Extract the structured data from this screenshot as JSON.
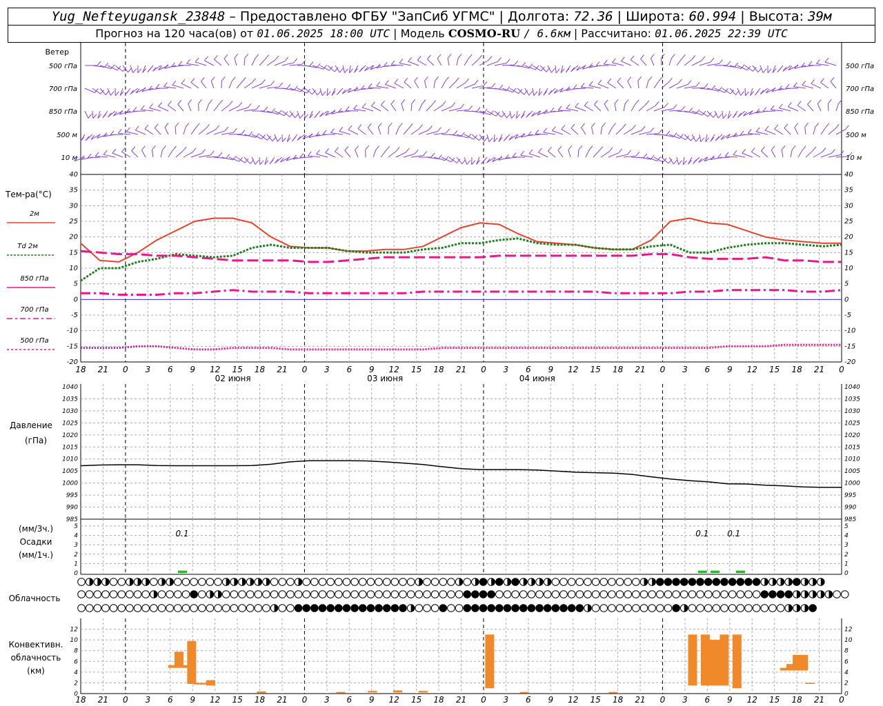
{
  "header": {
    "station": "Yug_Nefteyugansk_23848",
    "provided_by": "– Предоставлено ФГБУ \"ЗапСиб УГМС\"",
    "lon_label": "Долгота:",
    "lon_value": "72.36",
    "lat_label": "Широта:",
    "lat_value": "60.994",
    "alt_label": "Высота:",
    "alt_value": "39м",
    "forecast_label": "Прогноз на 120 часа(ов) от",
    "forecast_time": "01.06.2025 18:00 UTC",
    "model_label": "Модель",
    "model_name": "COSMO-RU",
    "model_res": "/ 6.6км",
    "calc_label": "Рассчитано:",
    "calc_time": "01.06.2025 22:39 UTC",
    "sep": "|"
  },
  "colors": {
    "t2m": "#e8402a",
    "td": "#1e7f1e",
    "t850": "#e8178c",
    "t700": "#e8178c",
    "t500": "#e8178c",
    "wind": "#8a3fd6",
    "pressure": "#000000",
    "precip": "#22bb22",
    "convective": "#f0892a",
    "zero_line": "#3333ff"
  },
  "chart_data": [
    {
      "type": "wind_barbs",
      "title": "Ветер",
      "levels": [
        "500 гПа",
        "700 гПа",
        "850 гПа",
        "500 м",
        "10 м"
      ]
    },
    {
      "type": "line",
      "ylabel": "Тем-ра(°C)",
      "ylim": [
        -20,
        40
      ],
      "ytick_labels": [
        "40",
        "35",
        "30",
        "25",
        "20",
        "15",
        "10",
        "5",
        "0",
        "-5",
        "-10",
        "-15",
        "-20"
      ],
      "x_hours": [
        0,
        3,
        6,
        9,
        12,
        15,
        18,
        21,
        24,
        27,
        30,
        33,
        36,
        39,
        42,
        45,
        48,
        51,
        54,
        57,
        60,
        63,
        66,
        69,
        72,
        75,
        78,
        81,
        84,
        87,
        90,
        93,
        96,
        99,
        102,
        105,
        108,
        111,
        114,
        117,
        120
      ],
      "series": [
        {
          "name": "2м",
          "values": [
            18,
            12.5,
            12,
            15,
            19,
            22,
            25,
            26,
            26,
            24.5,
            20,
            17,
            16.5,
            16.5,
            15.5,
            15.5,
            16,
            16,
            17,
            20,
            23,
            24.5,
            24,
            21,
            18.5,
            18,
            17.5,
            16.5,
            16,
            16,
            19,
            25,
            26,
            24.5,
            24,
            22,
            20,
            19,
            18.5,
            18,
            18
          ]
        },
        {
          "name": "Td 2м",
          "values": [
            6,
            10,
            10,
            12,
            13,
            14.5,
            14,
            13.5,
            14,
            16.5,
            17.5,
            16.5,
            16.5,
            16.5,
            15.5,
            15,
            15,
            15,
            16,
            16.5,
            18,
            18,
            19,
            19.5,
            18,
            17.5,
            17.5,
            16.5,
            16,
            16,
            17,
            17.5,
            15,
            15,
            16.5,
            17.5,
            18,
            18,
            17.5,
            17,
            17.5
          ]
        },
        {
          "name": "850 гПа",
          "values": [
            15.5,
            15,
            14.5,
            14.5,
            14,
            14,
            13.5,
            13,
            12.5,
            12.5,
            12.5,
            12.5,
            12,
            12,
            12.5,
            13,
            13.5,
            13.5,
            13.5,
            13.5,
            13.5,
            13.5,
            14,
            14,
            14,
            14,
            14,
            14,
            14,
            14,
            14.5,
            14.5,
            13.5,
            13,
            13,
            13,
            13.5,
            12.5,
            12.5,
            12,
            12
          ]
        },
        {
          "name": "700 гПа",
          "values": [
            2,
            2,
            1.5,
            1.5,
            1.5,
            2,
            2,
            2.5,
            3,
            2.5,
            2.5,
            2.5,
            2,
            2,
            2,
            2,
            2,
            2,
            2.5,
            2.5,
            2.5,
            2.5,
            2.5,
            2.5,
            2.5,
            2.5,
            2.5,
            2.5,
            2,
            2,
            2,
            2,
            2.5,
            2.5,
            3,
            3,
            3,
            3,
            2.5,
            2.5,
            3
          ]
        },
        {
          "name": "500 гПа",
          "values": [
            -15.5,
            -15.5,
            -15.5,
            -15,
            -15,
            -15.5,
            -16,
            -16,
            -15.5,
            -15.5,
            -15.5,
            -16,
            -16,
            -16,
            -16,
            -16,
            -16,
            -16,
            -16,
            -15.5,
            -15.5,
            -15.5,
            -15.5,
            -15.5,
            -15.5,
            -15.5,
            -15.5,
            -15.5,
            -15.5,
            -15.5,
            -15.5,
            -15.5,
            -15.5,
            -15.5,
            -15,
            -15,
            -15,
            -14.5,
            -14.5,
            -14.5,
            -14.5
          ]
        }
      ]
    },
    {
      "type": "line",
      "ylabel": "Давление",
      "ylabel2": "(гПа)",
      "ylim": [
        985,
        1040
      ],
      "ytick_labels": [
        "1040",
        "1035",
        "1030",
        "1025",
        "1020",
        "1015",
        "1010",
        "1005",
        "1000",
        "995",
        "990",
        "985"
      ],
      "series": [
        {
          "name": "pressure",
          "values": [
            1007.2,
            1007.5,
            1007.6,
            1007.6,
            1007.3,
            1007.2,
            1007.2,
            1007.2,
            1007.2,
            1007.3,
            1007.8,
            1008.8,
            1009.3,
            1009.3,
            1009.3,
            1009.2,
            1008.8,
            1008.3,
            1007.7,
            1006.8,
            1006,
            1005.6,
            1005.6,
            1005.6,
            1005.4,
            1005,
            1004.5,
            1004.3,
            1004.1,
            1003.6,
            1002.6,
            1001.7,
            1001,
            1000.5,
            999.7,
            999.6,
            999.1,
            998.8,
            998.4,
            998.2,
            998.2
          ]
        }
      ]
    },
    {
      "type": "bar",
      "ylabel": "(мм/3ч.)",
      "ylabel2": "Осадки",
      "ylabel3": "(мм/1ч.)",
      "ylim": [
        0,
        5
      ],
      "ytick_labels": [
        "5",
        "4",
        "3",
        "2",
        "1",
        "0"
      ],
      "bars": [
        {
          "x": 16,
          "value": 0.1
        },
        {
          "x": 98,
          "value": 0.1
        },
        {
          "x": 100,
          "value": 0.1
        },
        {
          "x": 104,
          "value": 0.1
        }
      ],
      "annotations": [
        {
          "x": 16,
          "text": "0.1"
        },
        {
          "x": 98,
          "text": "0.1"
        },
        {
          "x": 103,
          "text": "0.1"
        }
      ]
    },
    {
      "type": "table",
      "title": "Облачность",
      "rows": [
        "ohhhoohhhohhoooooohhhhhhooohoooooooooooooohoooohohfhfhfhhhhooooooooooohhfffffffffffffhhhhfhhh",
        "ooooooooohoooofohhooooooooooooooooooooooooooooooffffoooooooooooooooooooooooooooooooooffffhhhhhooo",
        "oooooooooooooooooooooooohooffffffffffffffhooofoofffffffffffffffhoooooooooofhoooooooooooohhhf"
      ]
    },
    {
      "type": "bar",
      "ylabel": "Конвективн.",
      "ylabel2": "облачность",
      "ylabel3": "(км)",
      "ylim": [
        0,
        14
      ],
      "ytick_labels": [
        "12",
        "10",
        "8",
        "6",
        "4",
        "2",
        "0"
      ],
      "bars": [
        {
          "x": 14.5,
          "bottom": 4.8,
          "top": 5.3
        },
        {
          "x": 15.5,
          "bottom": 4.8,
          "top": 7.8
        },
        {
          "x": 16.5,
          "bottom": 4.8,
          "top": 5.3
        },
        {
          "x": 17.5,
          "bottom": 1.8,
          "top": 9.8
        },
        {
          "x": 18.5,
          "bottom": 1.7,
          "top": 2
        },
        {
          "x": 19.5,
          "bottom": 1.7,
          "top": 2
        },
        {
          "x": 20.5,
          "bottom": 1.5,
          "top": 2.5
        },
        {
          "x": 28.5,
          "bottom": 0.1,
          "top": 0.4
        },
        {
          "x": 41,
          "bottom": 0.1,
          "top": 0.3
        },
        {
          "x": 46,
          "bottom": 0.2,
          "top": 0.5
        },
        {
          "x": 50,
          "bottom": 0.2,
          "top": 0.6
        },
        {
          "x": 54,
          "bottom": 0.2,
          "top": 0.5
        },
        {
          "x": 64.5,
          "bottom": 1,
          "top": 11
        },
        {
          "x": 70,
          "bottom": 0.1,
          "top": 0.3
        },
        {
          "x": 84,
          "bottom": 0.1,
          "top": 0.3
        },
        {
          "x": 96.5,
          "bottom": 1.5,
          "top": 11
        },
        {
          "x": 98.5,
          "bottom": 1.5,
          "top": 11
        },
        {
          "x": 99.5,
          "bottom": 1.5,
          "top": 10
        },
        {
          "x": 100.5,
          "bottom": 1.5,
          "top": 10
        },
        {
          "x": 101.5,
          "bottom": 1.5,
          "top": 11
        },
        {
          "x": 103.5,
          "bottom": 1,
          "top": 11
        },
        {
          "x": 111,
          "bottom": 4.3,
          "top": 4.8
        },
        {
          "x": 112,
          "bottom": 4.3,
          "top": 5.5
        },
        {
          "x": 113,
          "bottom": 4.3,
          "top": 7.2
        },
        {
          "x": 114,
          "bottom": 4.3,
          "top": 7.2
        },
        {
          "x": 115,
          "bottom": 1.8,
          "top": 2
        }
      ]
    }
  ],
  "x_axis": {
    "tick_labels": [
      "18",
      "21",
      "0",
      "3",
      "6",
      "9",
      "12",
      "15",
      "18",
      "21",
      "0",
      "3",
      "6",
      "9",
      "12",
      "15",
      "18",
      "21",
      "0",
      "3",
      "6",
      "9",
      "12",
      "15",
      "18",
      "21",
      "0",
      "3",
      "6",
      "9",
      "12",
      "15",
      "18",
      "21",
      "0"
    ],
    "day_labels": [
      {
        "x": 24,
        "text": "02 июня"
      },
      {
        "x": 48,
        "text": "03 июня"
      },
      {
        "x": 72,
        "text": "04 июня"
      }
    ],
    "midnights": [
      6,
      30,
      54,
      78,
      102
    ]
  },
  "legend": [
    {
      "label": "2м"
    },
    {
      "label": "Td  2м"
    },
    {
      "label": "850 гПа"
    },
    {
      "label": "700 гПа"
    },
    {
      "label": "500 гПа"
    }
  ]
}
